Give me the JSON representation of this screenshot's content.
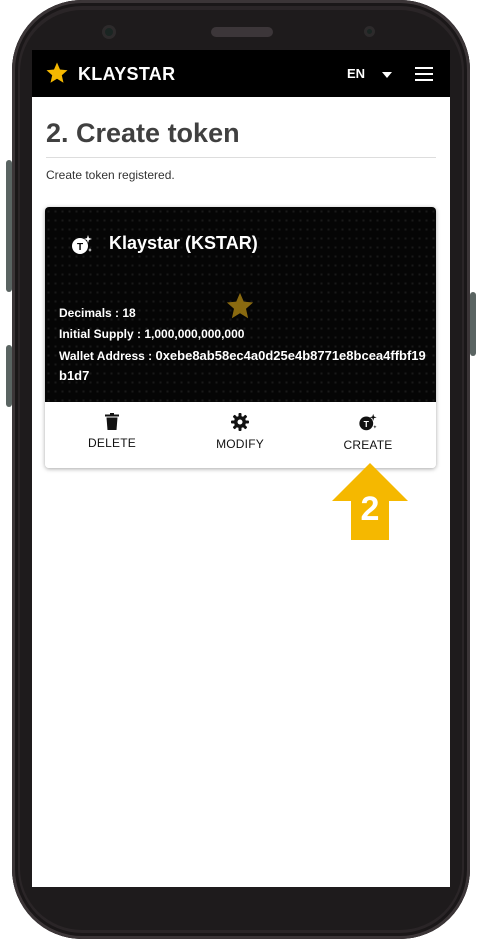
{
  "appbar": {
    "brand": "KLAYSTAR",
    "language": "EN",
    "logo_icon": "star-icon",
    "menu_icon": "hamburger-menu-icon",
    "brand_color": "#F5B800"
  },
  "page": {
    "title": "2. Create token",
    "status": "Create token registered."
  },
  "token_card": {
    "name": "Klaystar (KSTAR)",
    "decimals_label": "Decimals : ",
    "decimals": "18",
    "supply_label": "Initial Supply : ",
    "supply": "1,000,000,000,000",
    "address_label": "Wallet Address : ",
    "address": "0xebe8ab58ec4a0d25e4b8771e8bcea4ffbf19b1d7",
    "actions": [
      {
        "label": "DELETE",
        "icon": "trash-icon"
      },
      {
        "label": "MODIFY",
        "icon": "gear-icon"
      },
      {
        "label": "CREATE",
        "icon": "token-create-icon"
      }
    ]
  },
  "annotation": {
    "step_number": "2",
    "arrow_color": "#F5B800"
  }
}
